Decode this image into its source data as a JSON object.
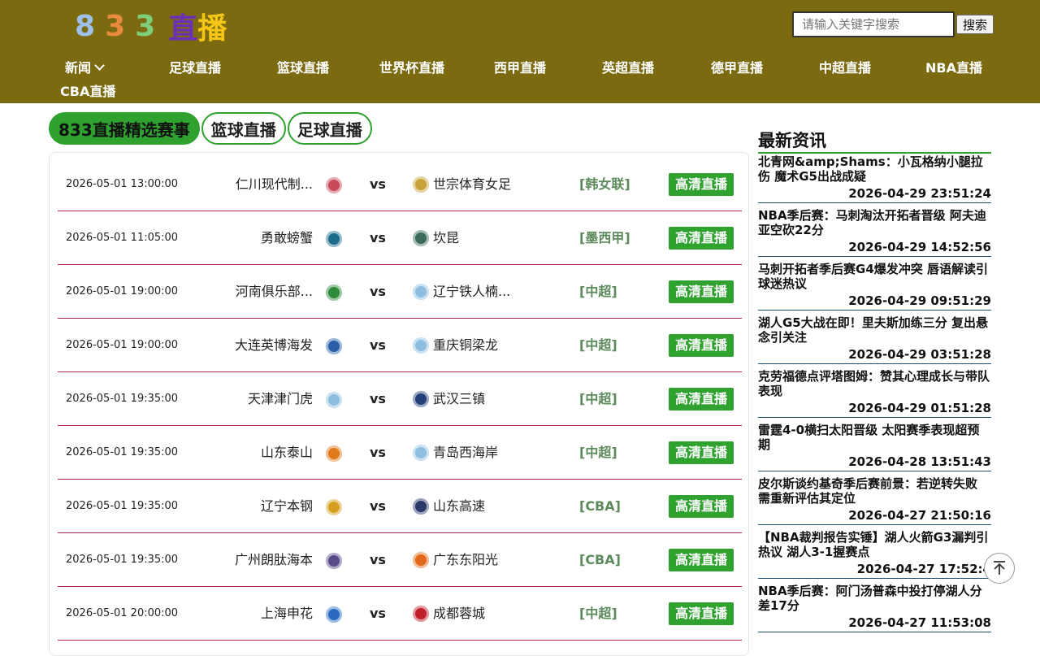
{
  "header": {
    "logo": {
      "d1": "8",
      "d2": "3",
      "d3": "3",
      "z1": "直",
      "z2": "播"
    },
    "search": {
      "placeholder": "请输入关键字搜索",
      "button": "搜索"
    },
    "nav": [
      "新闻",
      "足球直播",
      "篮球直播",
      "世界杯直播",
      "西甲直播",
      "英超直播",
      "德甲直播",
      "中超直播",
      "NBA直播",
      "CBA直播"
    ]
  },
  "tabs": [
    "833直播精选赛事",
    "篮球直播",
    "足球直播"
  ],
  "matches": [
    {
      "time": "2026-05-01 13:00:00",
      "home": "仁川现代制...",
      "away": "世宗体育女足",
      "league": "[韩女联]",
      "btn": "高清直播",
      "hcolor": "#c94a5a",
      "acolor": "#c9a23a"
    },
    {
      "time": "2026-05-01 11:05:00",
      "home": "勇敢螃蟹",
      "away": "坎昆",
      "league": "[墨西甲]",
      "btn": "高清直播",
      "hcolor": "#1c6b8a",
      "acolor": "#3a6a5a"
    },
    {
      "time": "2026-05-01 19:00:00",
      "home": "河南俱乐部...",
      "away": "辽宁铁人楠...",
      "league": "[中超]",
      "btn": "高清直播",
      "hcolor": "#2f8a3a",
      "acolor": "#8fbfe0"
    },
    {
      "time": "2026-05-01 19:00:00",
      "home": "大连英博海发",
      "away": "重庆铜梁龙",
      "league": "[中超]",
      "btn": "高清直播",
      "hcolor": "#2a5fa8",
      "acolor": "#8fbfe0"
    },
    {
      "time": "2026-05-01 19:35:00",
      "home": "天津津门虎",
      "away": "武汉三镇",
      "league": "[中超]",
      "btn": "高清直播",
      "hcolor": "#8fbfe0",
      "acolor": "#23407a"
    },
    {
      "time": "2026-05-01 19:35:00",
      "home": "山东泰山",
      "away": "青岛西海岸",
      "league": "[中超]",
      "btn": "高清直播",
      "hcolor": "#e07a1a",
      "acolor": "#8fbfe0"
    },
    {
      "time": "2026-05-01 19:35:00",
      "home": "辽宁本钢",
      "away": "山东高速",
      "league": "[CBA]",
      "btn": "高清直播",
      "hcolor": "#d8a020",
      "acolor": "#2a3a6a"
    },
    {
      "time": "2026-05-01 19:35:00",
      "home": "广州朗肽海本",
      "away": "广东东阳光",
      "league": "[CBA]",
      "btn": "高清直播",
      "hcolor": "#5a4a8a",
      "acolor": "#e06a1a"
    },
    {
      "time": "2026-05-01 20:00:00",
      "home": "上海申花",
      "away": "成都蓉城",
      "league": "[中超]",
      "btn": "高清直播",
      "hcolor": "#2a6ac0",
      "acolor": "#c0202a"
    }
  ],
  "news": {
    "title": "最新资讯",
    "items": [
      {
        "title": "北青网&amp;Shams：小瓦格纳小腿拉伤 魔术G5出战成疑",
        "date": "2026-04-29 23:51:24"
      },
      {
        "title": "NBA季后赛：马刺淘汰开拓者晋级 阿夫迪亚空砍22分",
        "date": "2026-04-29 14:52:56"
      },
      {
        "title": "马刺开拓者季后赛G4爆发冲突 唇语解读引球迷热议",
        "date": "2026-04-29 09:51:29"
      },
      {
        "title": "湖人G5大战在即！里夫斯加练三分 复出悬念引关注",
        "date": "2026-04-29 03:51:28"
      },
      {
        "title": "克劳福德点评塔图姆：赞其心理成长与带队表现",
        "date": "2026-04-29 01:51:28"
      },
      {
        "title": "雷霆4-0横扫太阳晋级 太阳赛季表现超预期",
        "date": "2026-04-28 13:51:43"
      },
      {
        "title": "皮尔斯谈约基奇季后赛前景：若逆转失败 需重新评估其定位",
        "date": "2026-04-27 21:50:16"
      },
      {
        "title": "【NBA裁判报告实锤】湖人火箭G3漏判引热议 湖人3-1握赛点",
        "date": "2026-04-27 17:52:4"
      },
      {
        "title": "NBA季后赛：阿门汤普森中投打停湖人分差17分",
        "date": "2026-04-27 11:53:08"
      }
    ]
  },
  "colors": {
    "header_bg": "#7b6a10",
    "accent_green": "#2ea12e",
    "row_divider": "#a9204a"
  },
  "icons": {
    "nav_dropdown": "chevron-down-icon",
    "back_to_top": "arrow-up-icon"
  }
}
